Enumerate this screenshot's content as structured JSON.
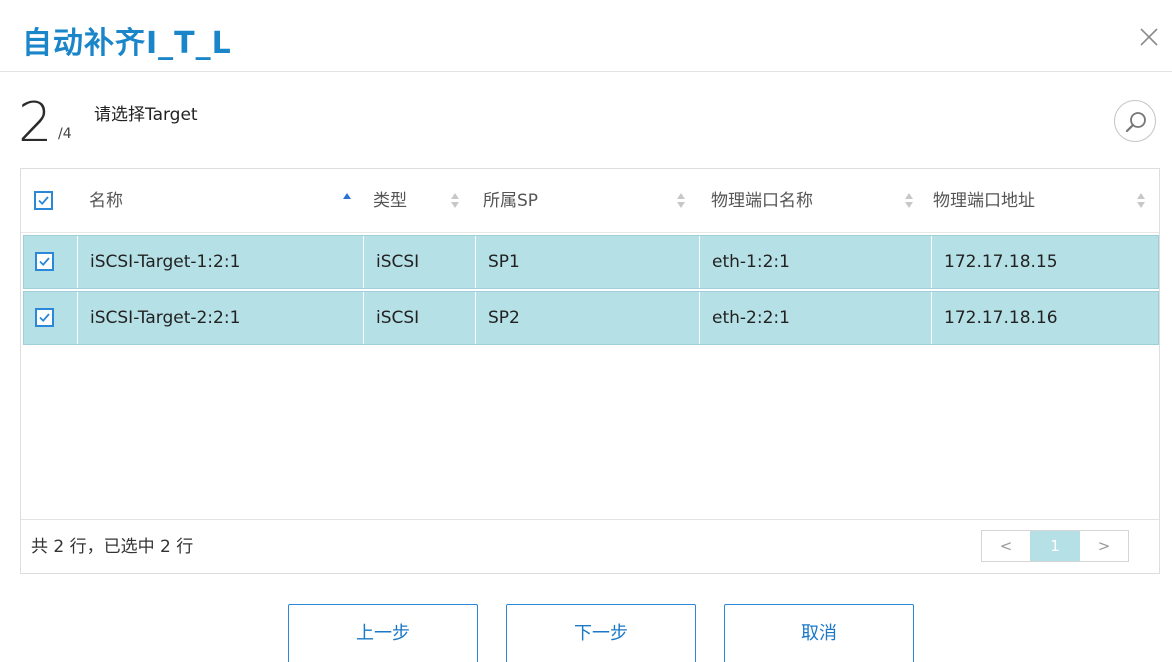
{
  "dialog": {
    "title": "自动补齐I_T_L"
  },
  "step": {
    "current": "2",
    "total": "/4",
    "label": "请选择Target"
  },
  "table": {
    "columns": [
      {
        "label": "名称",
        "sort": "asc"
      },
      {
        "label": "类型",
        "sort": "none"
      },
      {
        "label": "所属SP",
        "sort": "none"
      },
      {
        "label": "物理端口名称",
        "sort": "none"
      },
      {
        "label": "物理端口地址",
        "sort": "none"
      }
    ],
    "rows": [
      {
        "checked": true,
        "name": "iSCSI-Target-1:2:1",
        "type": "iSCSI",
        "sp": "SP1",
        "port_name": "eth-1:2:1",
        "port_address": "172.17.18.15"
      },
      {
        "checked": true,
        "name": "iSCSI-Target-2:2:1",
        "type": "iSCSI",
        "sp": "SP2",
        "port_name": "eth-2:2:1",
        "port_address": "172.17.18.16"
      }
    ],
    "summary": "共 2 行，已选中 2 行",
    "pagination": {
      "prev": "<",
      "current_page": "1",
      "next": ">"
    }
  },
  "buttons": {
    "prev": "上一步",
    "next": "下一步",
    "cancel": "取消"
  },
  "colors": {
    "accent": "#1a86c9",
    "selected_row": "#b5e0e6",
    "checkbox": "#2b88d8"
  }
}
